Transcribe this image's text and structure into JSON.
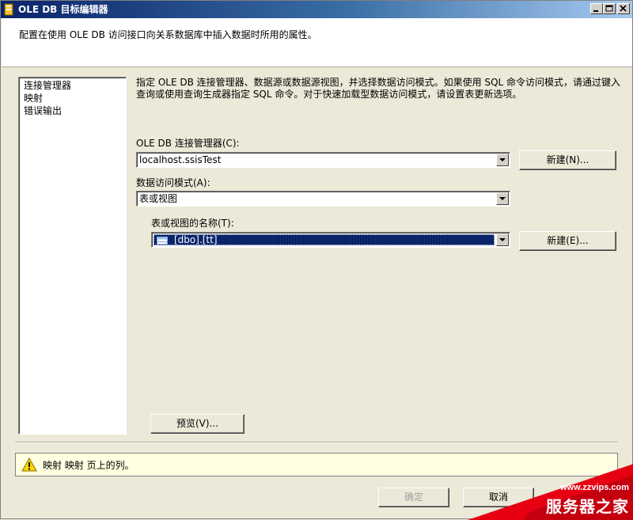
{
  "window": {
    "title": "OLE DB 目标编辑器",
    "min_glyph": "_",
    "max_glyph": "□",
    "close_glyph": "×"
  },
  "header": {
    "description": "配置在使用 OLE DB 访问接口向关系数据库中插入数据时所用的属性。"
  },
  "nav": {
    "items": [
      {
        "label": "连接管理器"
      },
      {
        "label": "映射"
      },
      {
        "label": "错误输出"
      }
    ]
  },
  "main": {
    "instruction": "指定 OLE DB 连接管理器、数据源或数据源视图，并选择数据访问模式。如果使用 SQL 命令访问模式，请通过键入查询或使用查询生成器指定 SQL 命令。对于快速加载型数据访问模式，请设置表更新选项。",
    "connection_label": "OLE DB 连接管理器(C):",
    "connection_value": "localhost.ssisTest",
    "connection_new_button": "新建(N)...",
    "access_mode_label": "数据访问模式(A):",
    "access_mode_value": "表或视图",
    "table_label": "表或视图的名称(T):",
    "table_value": "[dbo].[tt]",
    "table_new_button": "新建(E)...",
    "preview_button": "预览(V)..."
  },
  "message": {
    "text": "映射 映射 页上的列。",
    "icon": "warning-icon"
  },
  "footer": {
    "ok_button": "确定",
    "cancel_button": "取消"
  },
  "watermark": {
    "url": "www.zzvips.com",
    "name": "服务器之家"
  },
  "colors": {
    "title_bar": "#0a246a",
    "selection": "#0a246a",
    "message_bg": "#ffffe1",
    "watermark_red": "#e60012"
  }
}
